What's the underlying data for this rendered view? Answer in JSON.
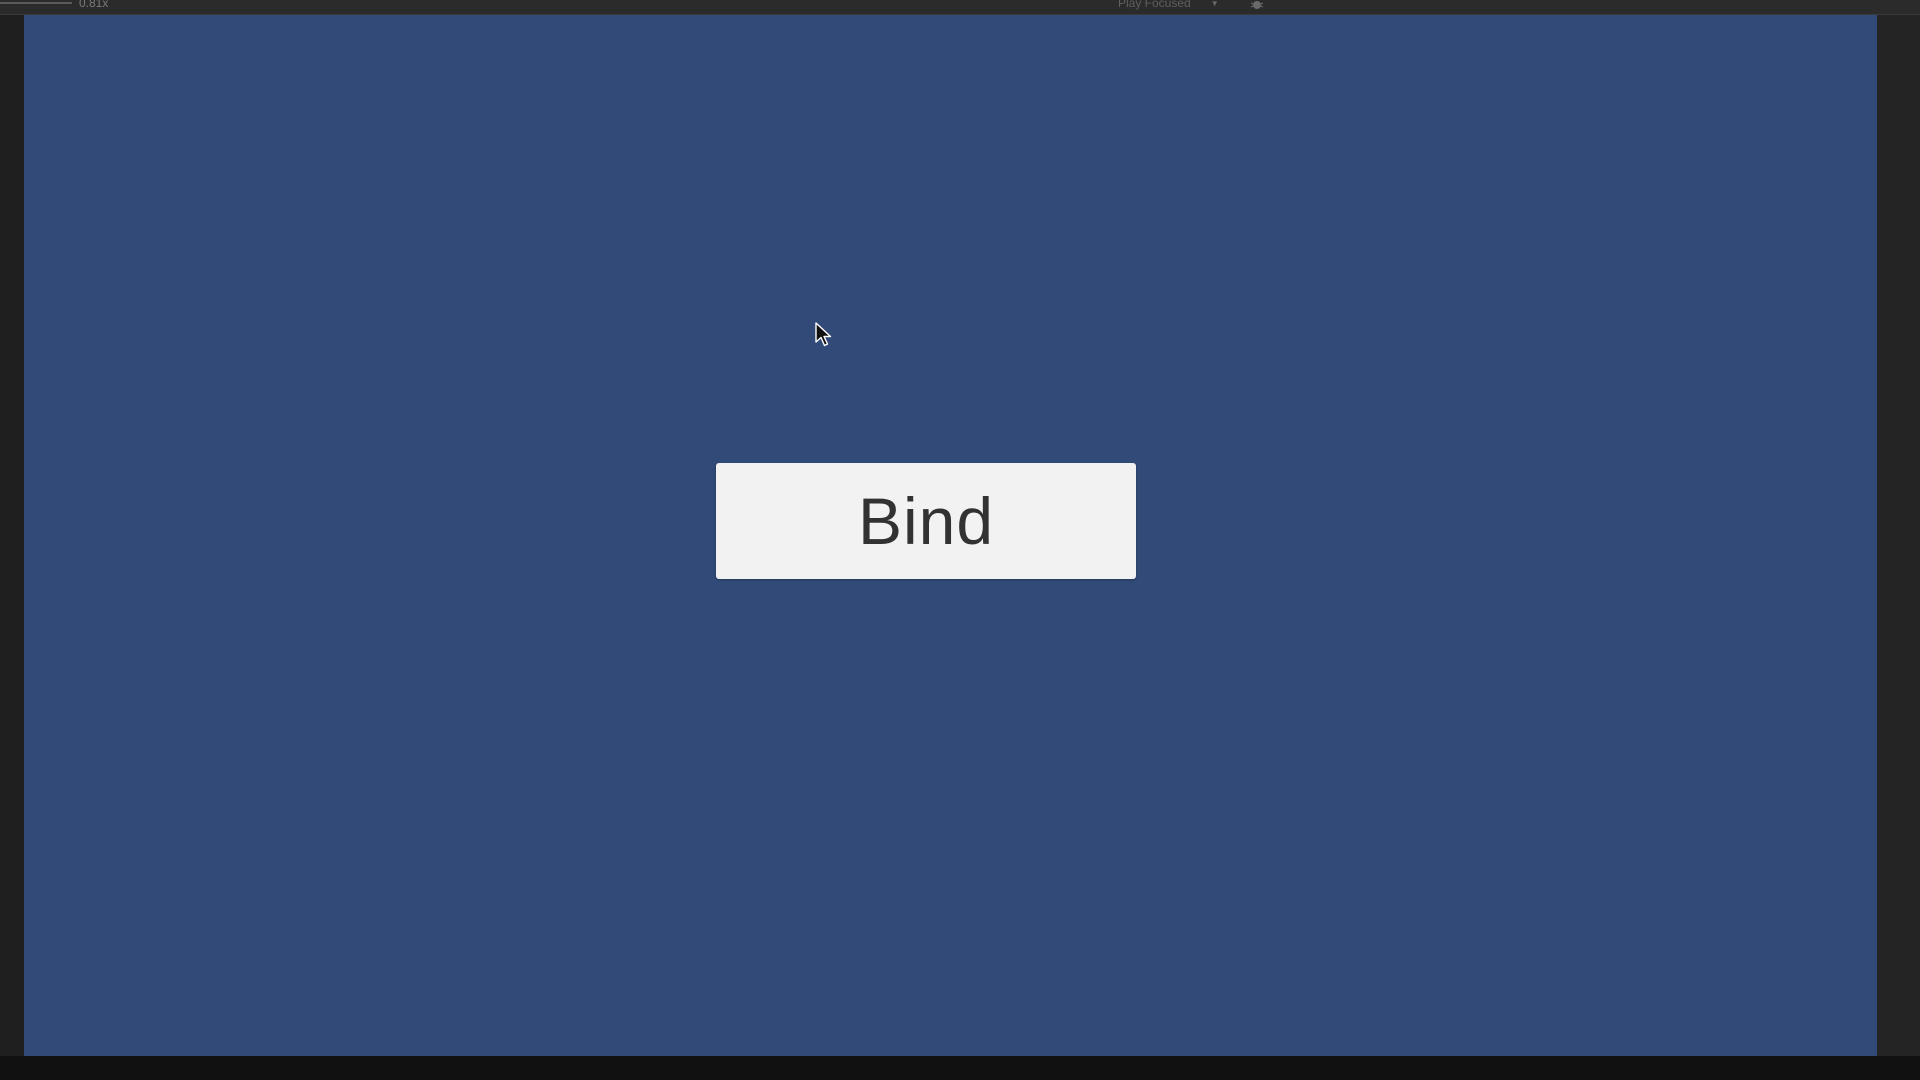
{
  "toolbar": {
    "scale_label": "0.81x",
    "play_mode_label": "Play Focused",
    "play_mode_icon": "chevron-down-icon",
    "stats_icon": "bug-icon"
  },
  "game_view": {
    "background_color": "#314a77",
    "button": {
      "label": "Bind",
      "background_color": "#f2f2f2",
      "text_color": "#323232"
    },
    "cursor_icon": "mouse-pointer-icon"
  }
}
